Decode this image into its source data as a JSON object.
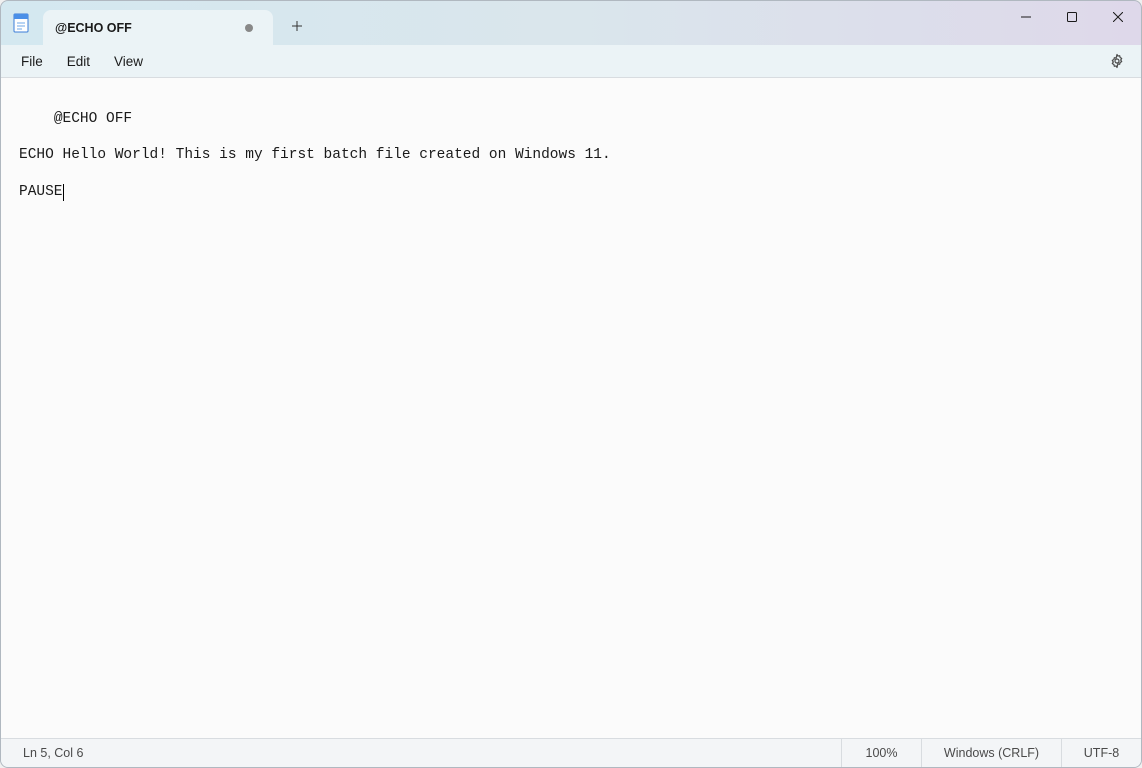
{
  "tab": {
    "title": "@ECHO OFF"
  },
  "menu": {
    "file": "File",
    "edit": "Edit",
    "view": "View"
  },
  "editor": {
    "content": "@ECHO OFF\n\nECHO Hello World! This is my first batch file created on Windows 11.\n\nPAUSE"
  },
  "statusbar": {
    "position": "Ln 5, Col 6",
    "zoom": "100%",
    "line_ending": "Windows (CRLF)",
    "encoding": "UTF-8"
  }
}
